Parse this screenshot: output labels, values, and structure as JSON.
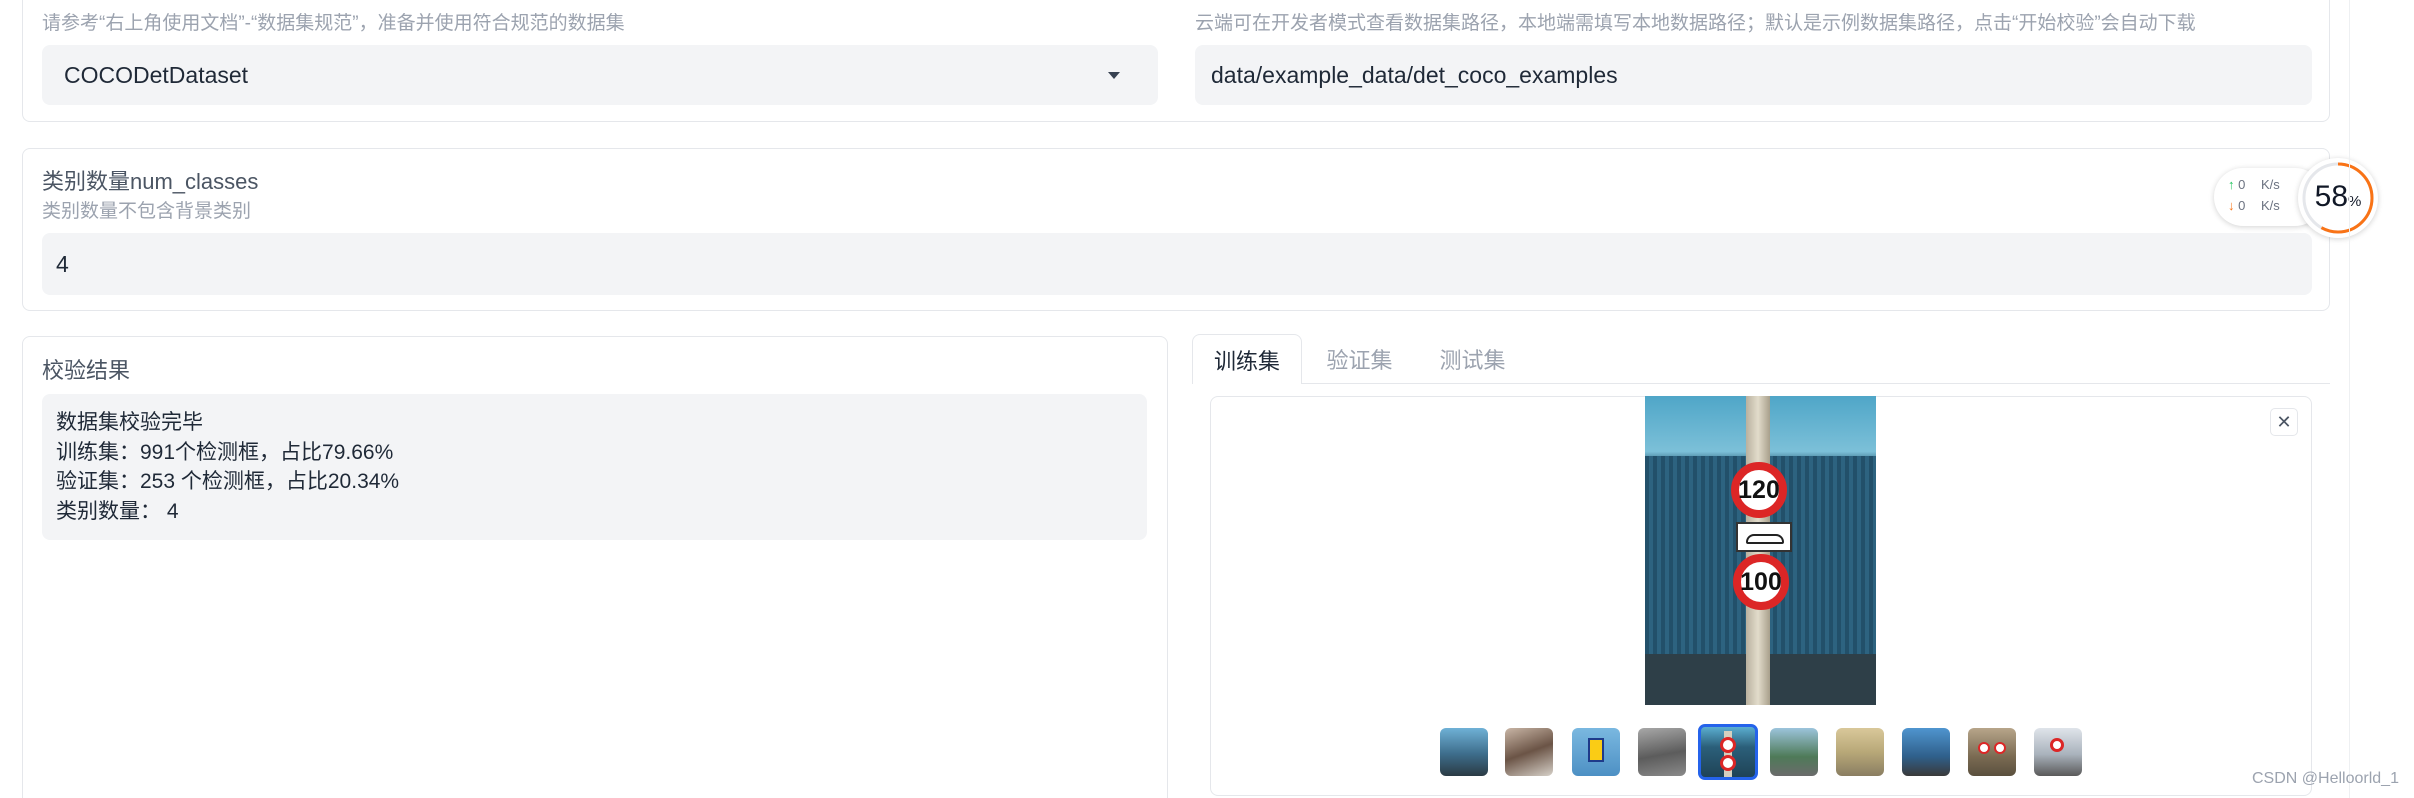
{
  "dataset_section": {
    "format_hint": "请参考“右上角使用文档”-“数据集规范”，准备并使用符合规范的数据集",
    "format_value": "COCODetDataset",
    "path_hint": "云端可在开发者模式查看数据集路径，本地端需填写本地数据路径；默认是示例数据集路径，点击“开始校验”会自动下载",
    "path_value": "data/example_data/det_coco_examples"
  },
  "num_classes_section": {
    "label": "类别数量num_classes",
    "hint": "类别数量不包含背景类别",
    "value": "4"
  },
  "result_section": {
    "label": "校验结果",
    "lines": [
      "数据集校验完毕",
      "训练集：991个检测框，占比79.66%",
      "验证集：253 个检测框，占比20.34%",
      "类别数量： 4"
    ]
  },
  "gallery": {
    "tabs": [
      "训练集",
      "验证集",
      "测试集"
    ],
    "active_tab": 0,
    "thumbnail_count": 10,
    "selected_thumbnail": 4,
    "main_image": {
      "sign_top": "120",
      "sign_bottom": "100"
    }
  },
  "speed_widget": {
    "up_value": "0",
    "up_unit": "K/s",
    "down_value": "0",
    "down_unit": "K/s",
    "percent": "58",
    "percent_symbol": "%",
    "percent_fraction": 0.58
  },
  "watermark": "CSDN @Helloorld_1",
  "colors": {
    "accent": "#2563eb",
    "field_bg": "#f3f4f6",
    "gauge": "#f97316",
    "sign_red": "#dc2626"
  }
}
